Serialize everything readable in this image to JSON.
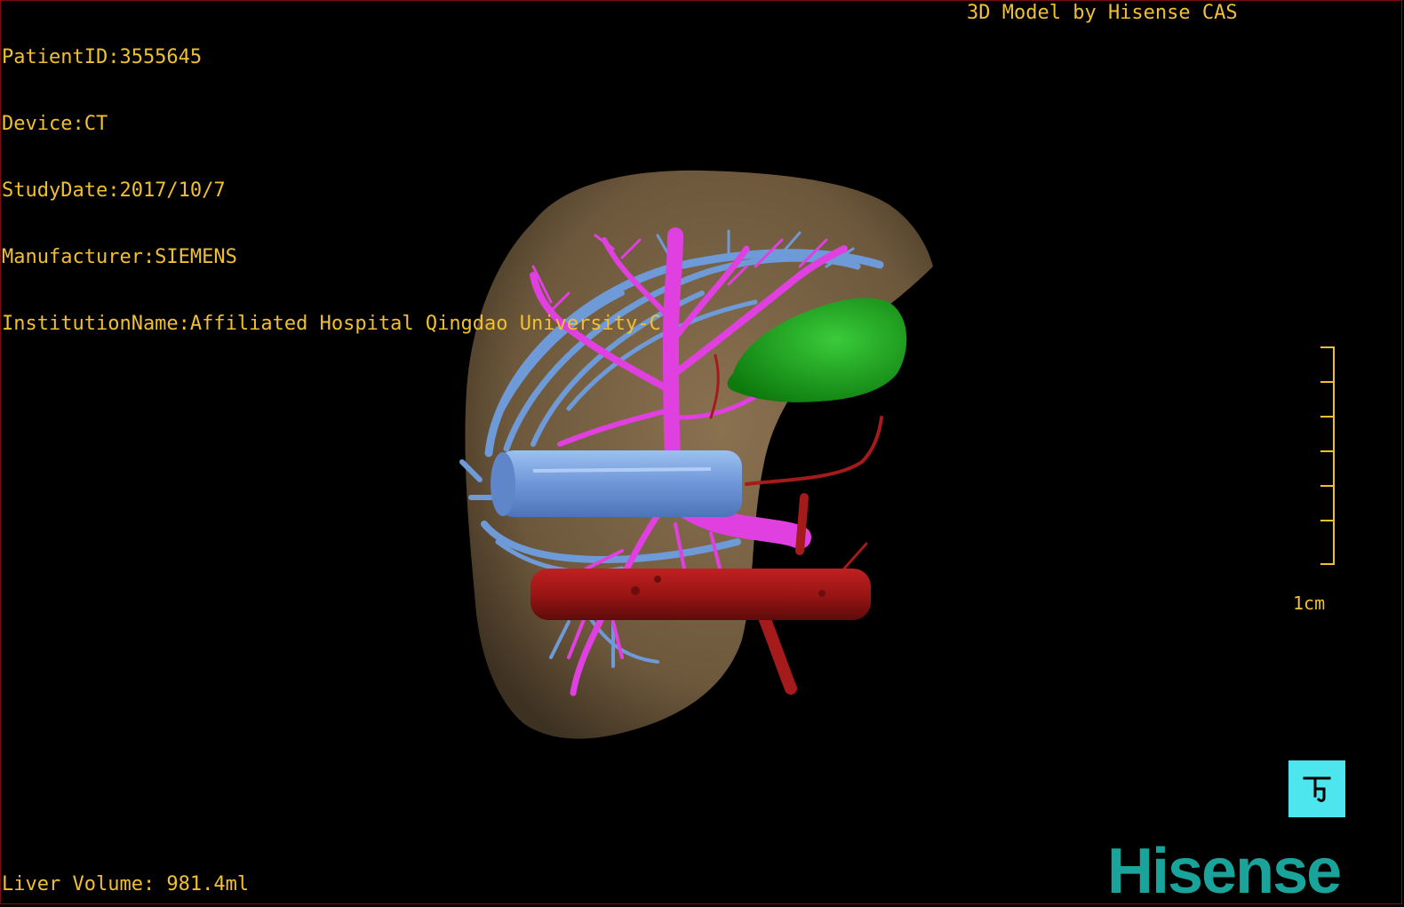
{
  "overlay": {
    "patient_id": "PatientID:3555645",
    "device": "Device:CT",
    "study_date": "StudyDate:2017/10/7",
    "manufacturer": "Manufacturer:SIEMENS",
    "institution": "InstitutionName:Affiliated Hospital Qingdao University-C",
    "model_credit": "3D Model by Hisense CAS",
    "liver_volume": "Liver Volume: 981.4ml"
  },
  "scale_bar": {
    "label": "1cm",
    "color": "#f0c030"
  },
  "orientation_button": {
    "icon": "orientation-icon",
    "color": "#4ee6ee"
  },
  "logo": {
    "text": "Hisense",
    "color": "#19a39a"
  },
  "model_colors": {
    "liver": "#7a6448",
    "hepatic_veins": "#6f9ad8",
    "portal_vein": "#e040e0",
    "inferior_vena_cava": "#7fa6e6",
    "artery_aorta": "#a51a1a",
    "gallbladder_green": "#1aa31a",
    "background": "#000000"
  }
}
